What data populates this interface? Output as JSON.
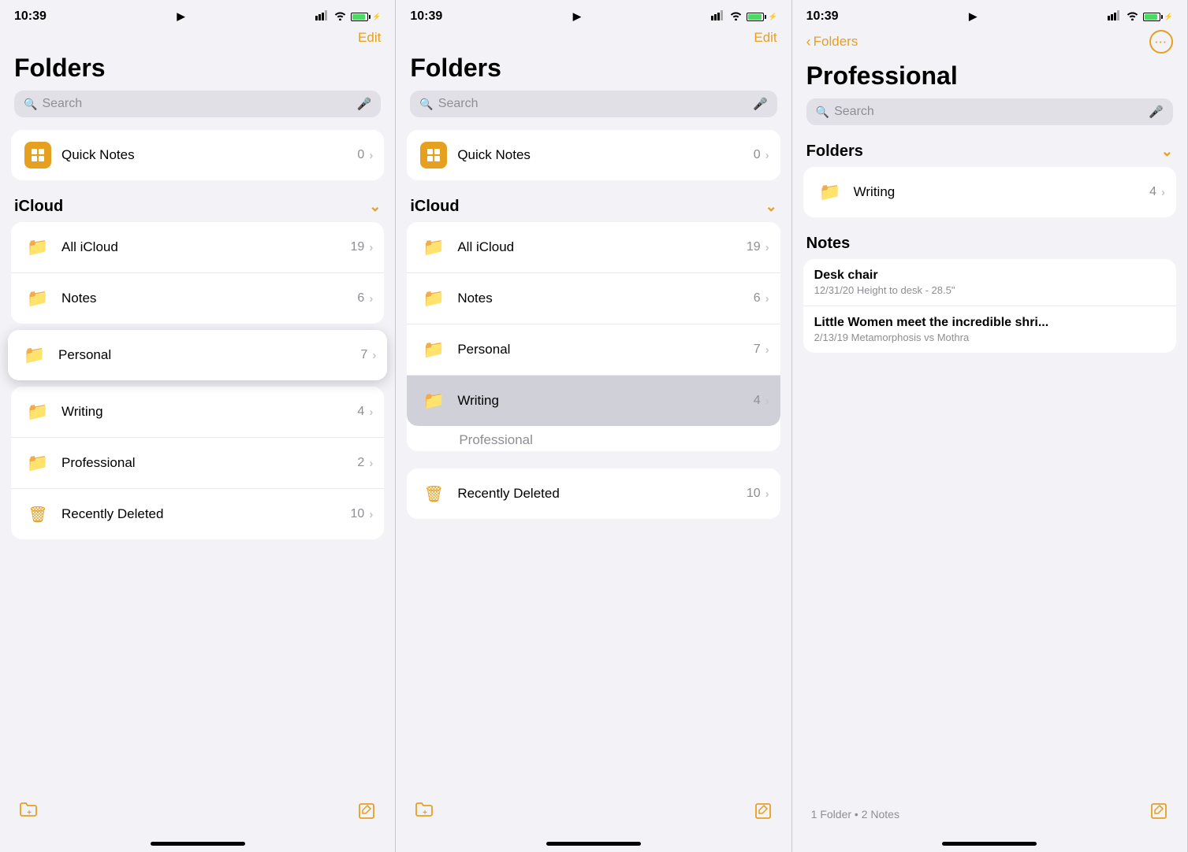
{
  "colors": {
    "accent": "#e6a020",
    "text_primary": "#000000",
    "text_secondary": "#8e8e93",
    "bg_page": "#f2f2f7",
    "bg_card": "#ffffff",
    "bg_search": "#e0e0e6",
    "chevron": "#c7c7cc"
  },
  "panel1": {
    "status_time": "10:39",
    "status_location": "◀",
    "nav_edit": "Edit",
    "title": "Folders",
    "search_placeholder": "Search",
    "quick_notes": {
      "label": "Quick Notes",
      "count": "0"
    },
    "icloud_section": "iCloud",
    "icloud_items": [
      {
        "label": "All iCloud",
        "count": "19"
      },
      {
        "label": "Notes",
        "count": "6"
      }
    ],
    "icloud_floating_item": {
      "label": "Personal",
      "count": "7"
    },
    "icloud_below_items": [
      {
        "label": "Writing",
        "count": "4"
      },
      {
        "label": "Professional",
        "count": "2"
      }
    ],
    "recently_deleted": {
      "label": "Recently Deleted",
      "count": "10"
    },
    "toolbar_new_folder": "🗂",
    "toolbar_compose": "✏"
  },
  "panel2": {
    "status_time": "10:39",
    "nav_edit": "Edit",
    "title": "Folders",
    "search_placeholder": "Search",
    "quick_notes": {
      "label": "Quick Notes",
      "count": "0"
    },
    "icloud_section": "iCloud",
    "icloud_items": [
      {
        "label": "All iCloud",
        "count": "19"
      },
      {
        "label": "Notes",
        "count": "6"
      },
      {
        "label": "Personal",
        "count": "7"
      }
    ],
    "writing_item": {
      "label": "Writing",
      "count": "4"
    },
    "professional_ghost": "Professional",
    "recently_deleted": {
      "label": "Recently Deleted",
      "count": "10"
    },
    "toolbar_new_folder": "🗂",
    "toolbar_compose": "✏"
  },
  "panel3": {
    "status_time": "10:39",
    "nav_back": "Folders",
    "title": "Professional",
    "search_placeholder": "Search",
    "folders_section": "Folders",
    "folders": [
      {
        "label": "Writing",
        "count": "4"
      }
    ],
    "notes_section": "Notes",
    "notes": [
      {
        "title": "Desk chair",
        "date": "12/31/20",
        "preview": "Height to desk - 28.5\""
      },
      {
        "title": "Little Women meet the incredible shri...",
        "date": "2/13/19",
        "preview": "Metamorphosis vs Mothra"
      }
    ],
    "footer": "1 Folder • 2 Notes",
    "toolbar_compose": "✏"
  }
}
